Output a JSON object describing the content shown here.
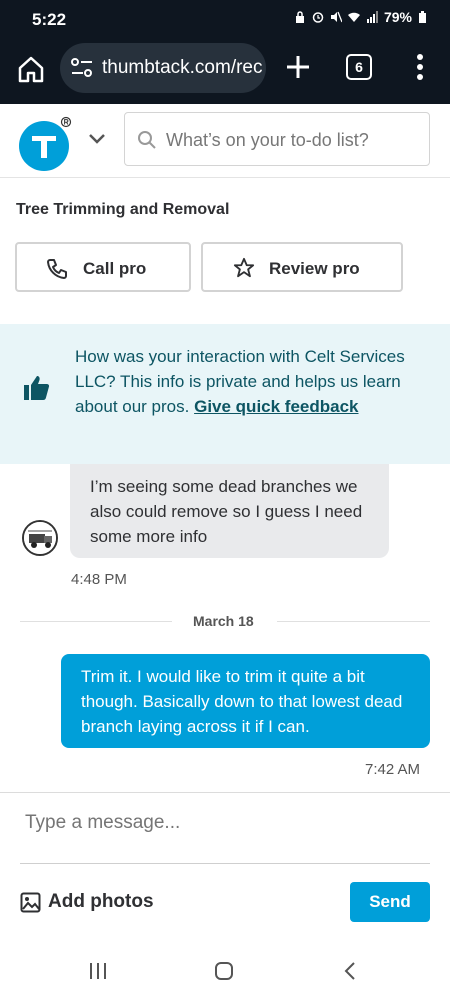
{
  "status_bar": {
    "time": "5:22",
    "battery": "79%"
  },
  "browser": {
    "url": "thumbtack.com/rec",
    "tab_count": "6"
  },
  "header": {
    "search_placeholder": "What’s on your to-do list?"
  },
  "job": {
    "title": "Tree Trimming and Removal"
  },
  "actions": {
    "call_label": "Call pro",
    "review_label": "Review pro"
  },
  "feedback_banner": {
    "text": "How was your interaction with Celt Services LLC? This info is private and helps us learn about our pros.",
    "link": "Give quick feedback"
  },
  "messages": [
    {
      "direction": "incoming",
      "text": "I’m seeing some dead branches we also could remove so I guess I need some more info",
      "time": "4:48 PM"
    },
    {
      "direction": "outgoing",
      "text": "Trim it. I would like to trim it quite a bit though. Basically down to that lowest dead branch laying across it if I can.",
      "time": "7:42 AM"
    }
  ],
  "date_separator": "March 18",
  "composer": {
    "placeholder": "Type a message...",
    "add_photos_label": "Add photos",
    "send_label": "Send"
  },
  "colors": {
    "accent": "#009fd9",
    "banner_bg": "#e8f5f8",
    "banner_text": "#0d5563",
    "browser_bar": "#0e1620"
  }
}
